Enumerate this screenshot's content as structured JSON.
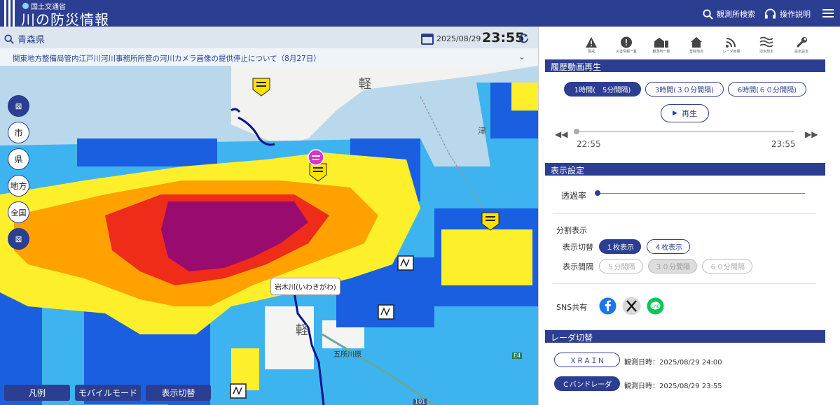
{
  "header": {
    "ministry": "国土交通省",
    "title": "川の防災情報",
    "search_label": "観測所検索",
    "help_label": "操作説明"
  },
  "map": {
    "prefecture": "青森県",
    "date": "2025/08/29",
    "time": "23:55",
    "notice": "関東地方整備局管内江戸川河川事務所所管の河川カメラ画像の提供停止について（8月27日）",
    "side_buttons": [
      "市",
      "県",
      "地方",
      "全国"
    ],
    "bottom_buttons": [
      "凡例",
      "モバイルモード",
      "表示切替"
    ],
    "river_label": "岩木川(いわきがわ)",
    "place_labels": {
      "karu": "軽",
      "karu2": "軽",
      "tsu": "津",
      "goshogawara": "五所川原",
      "sign_e4": "E4",
      "sign_101": "101"
    }
  },
  "panel": {
    "icon_captions": [
      "警戒",
      "災害情報一覧",
      "観測所一覧",
      "登録地点",
      "レーダ雨量",
      "浸水想定",
      "設定設定"
    ],
    "history": {
      "heading": "履歴動画再生",
      "intervals": [
        "1時間(　5分間隔)",
        "3時間(３０分間隔)",
        "6時間(６０分間隔)"
      ],
      "play_label": "再生",
      "start_time": "22:55",
      "end_time": "23:55"
    },
    "display": {
      "heading": "表示設定",
      "opacity_label": "透過率",
      "split_heading": "分割表示",
      "switch_label": "表示切替",
      "switch_options": [
        "１枚表示",
        "４枚表示"
      ],
      "interval_label": "表示間隔",
      "interval_options": [
        "５分間隔",
        "３０分間隔",
        "６０分間隔"
      ],
      "sns_label": "SNS共有"
    },
    "radar": {
      "heading": "レーダ切替",
      "options": [
        {
          "label": "ＸＲＡＩＮ",
          "observed": "観測日時：2025/08/29 24:00"
        },
        {
          "label": "Ｃバンドレーダ",
          "observed": "観測日時：2025/08/29 23:55"
        }
      ]
    }
  },
  "colors": {
    "brand": "#2c3e91",
    "rain_light": "#b9d8ec",
    "rain_mid": "#3db4f0",
    "rain_blue": "#1a5fe0",
    "rain_yellow": "#fdf02b",
    "rain_orange": "#ffa200",
    "rain_red": "#ee2c19",
    "rain_purple": "#9a0b6f"
  }
}
